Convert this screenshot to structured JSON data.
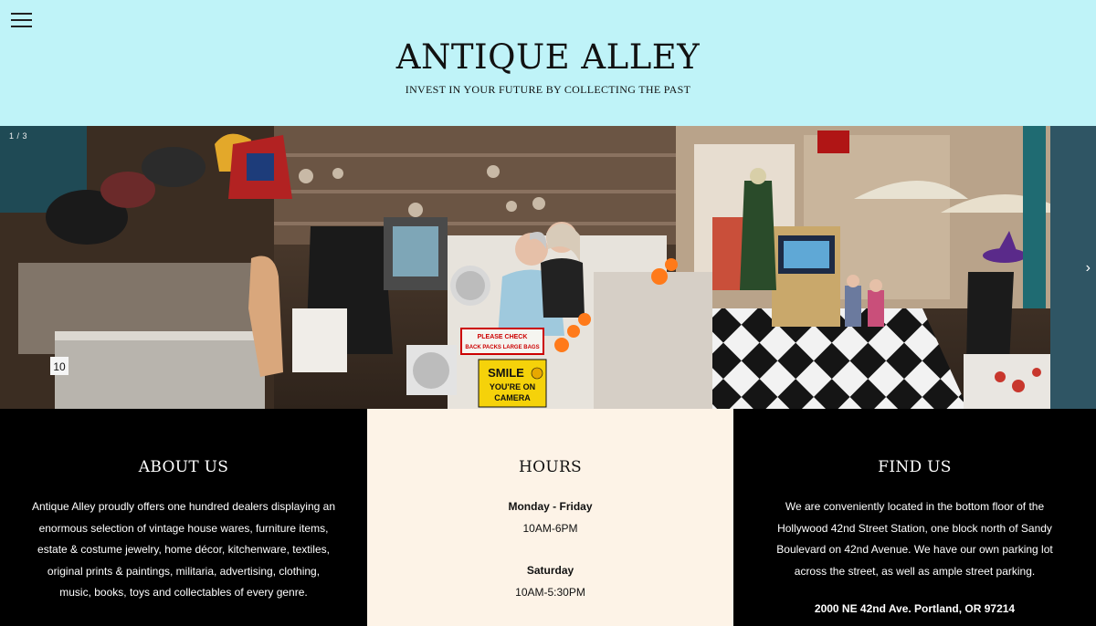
{
  "header": {
    "title": "ANTIQUE ALLEY",
    "tagline": "INVEST IN YOUR FUTURE BY COLLECTING THE PAST",
    "menu_icon": "hamburger-menu-icon",
    "background": "#bff3f8"
  },
  "slideshow": {
    "counter": "1 / 3",
    "next_arrow": "›",
    "signs": {
      "smile_line1": "SMILE",
      "smile_line2": "YOU'RE ON",
      "smile_line3": "CAMERA",
      "check_line1": "PLEASE CHECK",
      "check_line2": "BACK PACKS  LARGE BAGS",
      "booth_number": "10"
    }
  },
  "about": {
    "heading": "ABOUT US",
    "body": "Antique Alley proudly offers one hundred dealers displaying an enormous selection of vintage house wares, furniture items, estate & costume jewelry, home décor, kitchenware, textiles, original prints & paintings, militaria, advertising, clothing, music, books, toys and collectables of every genre."
  },
  "hours": {
    "heading": "HOURS",
    "schedule": [
      {
        "day": "Monday - Friday",
        "time": "10AM-6PM"
      },
      {
        "day": "Saturday",
        "time": "10AM-5:30PM"
      }
    ],
    "background": "#fdf3e7"
  },
  "find_us": {
    "heading": "FIND US",
    "body": "We are conveniently located in the bottom floor of the Hollywood 42nd Street Station, one block north of Sandy Boulevard on 42nd Avenue. We have our own parking lot across the street, as well as ample street parking.",
    "address": "2000 NE 42nd Ave. Portland, OR 97214"
  }
}
